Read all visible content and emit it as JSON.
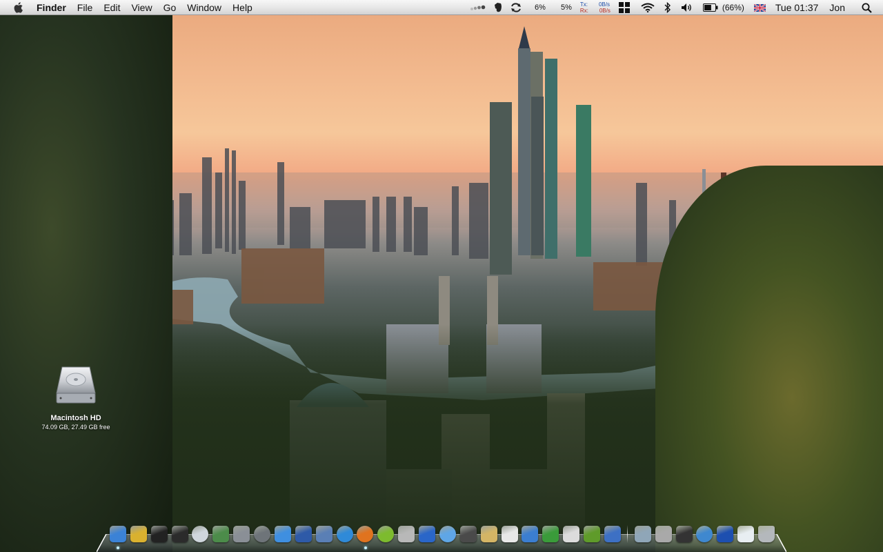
{
  "menubar": {
    "apple_icon": "apple-logo-icon",
    "app_name": "Finder",
    "menus": [
      "File",
      "Edit",
      "View",
      "Go",
      "Window",
      "Help"
    ],
    "status": {
      "activity_icon": "activity-dots-icon",
      "evernote_icon": "evernote-icon",
      "sync_icon": "sync-arrows-icon",
      "cpu1": "6%",
      "cpu2": "5%",
      "net_tx_label": "Tx:",
      "net_rx_label": "Rx:",
      "net_tx_value": "0B/s",
      "net_rx_value": "0B/s",
      "windows_icon": "windows-grid-icon",
      "wifi_icon": "wifi-icon",
      "bluetooth_icon": "bluetooth-icon",
      "volume_icon": "volume-icon",
      "battery_icon": "battery-icon",
      "battery_text": "(66%)",
      "battery_level": 0.66,
      "flag_icon": "uk-flag-icon",
      "clock": "Tue 01:37",
      "user": "Jon",
      "spotlight_icon": "spotlight-search-icon"
    }
  },
  "desktop": {
    "drive": {
      "icon": "hard-drive-icon",
      "name": "Macintosh HD",
      "info": "74.09 GB, 27.49 GB free"
    }
  },
  "dock": {
    "apps": [
      {
        "name": "finder",
        "color": "#3b82d6",
        "running": true
      },
      {
        "name": "keychain-lock",
        "color": "#d9b12f",
        "running": false
      },
      {
        "name": "terminal",
        "color": "#222222",
        "running": false
      },
      {
        "name": "activity-monitor",
        "color": "#2b2b2b",
        "running": false
      },
      {
        "name": "airport-utility",
        "color": "#cfd6dc",
        "running": false
      },
      {
        "name": "iphoto",
        "color": "#4c8c4a",
        "running": false
      },
      {
        "name": "system-preferences",
        "color": "#8a8f96",
        "running": false
      },
      {
        "name": "time-machine",
        "color": "#6e7479",
        "running": false
      },
      {
        "name": "ichat",
        "color": "#3f8fe0",
        "running": false
      },
      {
        "name": "address-book",
        "color": "#2e5aa8",
        "running": false
      },
      {
        "name": "preview",
        "color": "#5a7fb5",
        "running": false
      },
      {
        "name": "safari",
        "color": "#2f8ad8",
        "running": false
      },
      {
        "name": "firefox",
        "color": "#e0731f",
        "running": true
      },
      {
        "name": "coda",
        "color": "#7dbb2e",
        "running": false
      },
      {
        "name": "cyberduck",
        "color": "#b8b8b8",
        "running": false
      },
      {
        "name": "transmit",
        "color": "#2a66c8",
        "running": false
      },
      {
        "name": "itunes",
        "color": "#5fa6e6",
        "running": false
      },
      {
        "name": "front-row",
        "color": "#4a4a4a",
        "running": false
      },
      {
        "name": "mail",
        "color": "#d4b565",
        "running": false
      },
      {
        "name": "ical",
        "color": "#e8e8e8",
        "running": false
      },
      {
        "name": "wireshark-fin",
        "color": "#3b7ed0",
        "running": false
      },
      {
        "name": "growl",
        "color": "#3a9b3a",
        "running": false
      },
      {
        "name": "script-editor",
        "color": "#dcdcdc",
        "running": false
      },
      {
        "name": "dreamweaver",
        "color": "#5f9b2a",
        "running": false
      },
      {
        "name": "xcode",
        "color": "#3d70c4",
        "running": false
      },
      {
        "name": "applications-folder",
        "color": "#8fa6b8",
        "running": false
      },
      {
        "name": "utilities-folder",
        "color": "#a9a9a9",
        "running": false
      },
      {
        "name": "network-monitor",
        "color": "#333333",
        "running": false
      },
      {
        "name": "globe",
        "color": "#3f88cf",
        "running": false
      },
      {
        "name": "blue-app",
        "color": "#1d4fb0",
        "running": false
      },
      {
        "name": "document",
        "color": "#e8eef2",
        "running": false
      },
      {
        "name": "trash",
        "color": "#b4b8bc",
        "running": false
      }
    ]
  }
}
